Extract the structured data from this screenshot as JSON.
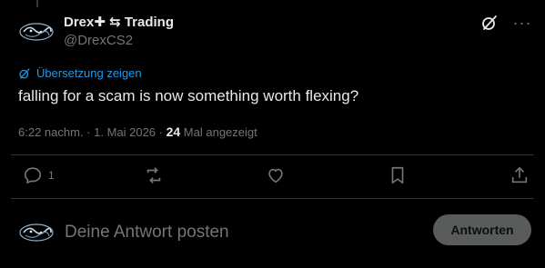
{
  "author": {
    "display_name": "Drex✚ ⇆ Trading",
    "handle": "@DrexCS2",
    "avatar_icon": "drex-logo-avatar"
  },
  "top_icons": [
    "grok-slash-icon",
    "more-icon"
  ],
  "more_label": "···",
  "translate_label": "Übersetzung zeigen",
  "tweet_text": "falling for a scam is now something worth flexing?",
  "meta": {
    "time": "6:22 nachm.",
    "separator1": " · ",
    "date": "1. Mai 2026",
    "separator2": " · ",
    "views": "24",
    "views_label": " Mal angezeigt"
  },
  "actions": {
    "reply_count": "1",
    "icons": [
      "reply-icon",
      "repost-icon",
      "like-icon",
      "bookmark-icon",
      "share-icon"
    ]
  },
  "reply_box": {
    "placeholder": "Deine Antwort posten",
    "button_label": "Antworten"
  },
  "colors": {
    "background": "#000000",
    "text": "#e7e9ea",
    "muted": "#71767b",
    "link": "#1d9bf0",
    "button_bg": "#787a7a"
  }
}
